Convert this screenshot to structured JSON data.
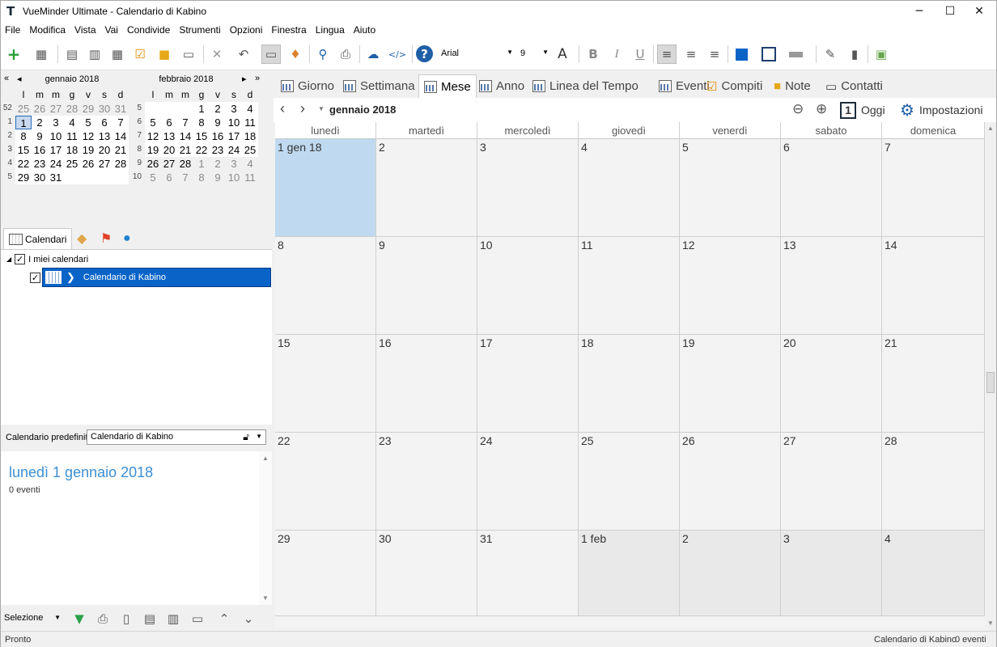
{
  "window": {
    "title": "VueMinder Ultimate - Calendario di Kabino",
    "logo": "T"
  },
  "window_controls": {
    "minimize": "─",
    "maximize": "☐",
    "close": "✕"
  },
  "menu": [
    "File",
    "Modifica",
    "Vista",
    "Vai",
    "Condivide",
    "Strumenti",
    "Opzioni",
    "Finestra",
    "Lingua",
    "Aiuto"
  ],
  "toolbar": {
    "font_name": "Arial",
    "font_size": "9",
    "font_size_glyph": "A",
    "bold": "B",
    "italic": "I",
    "underline": "U"
  },
  "mini_calendars": [
    {
      "title": "gennaio 2018",
      "dow": [
        "l",
        "m",
        "m",
        "g",
        "v",
        "s",
        "d"
      ],
      "weeks": [
        {
          "wk": "52",
          "days": [
            [
              "25",
              1
            ],
            [
              "26",
              1
            ],
            [
              "27",
              1
            ],
            [
              "28",
              1
            ],
            [
              "29",
              1
            ],
            [
              "30",
              1
            ],
            [
              "31",
              1
            ]
          ]
        },
        {
          "wk": "1",
          "days": [
            [
              "1",
              0
            ],
            [
              "2",
              0
            ],
            [
              "3",
              0
            ],
            [
              "4",
              0
            ],
            [
              "5",
              0
            ],
            [
              "6",
              0
            ],
            [
              "7",
              0
            ]
          ]
        },
        {
          "wk": "2",
          "days": [
            [
              "8",
              0
            ],
            [
              "9",
              0
            ],
            [
              "10",
              0
            ],
            [
              "11",
              0
            ],
            [
              "12",
              0
            ],
            [
              "13",
              0
            ],
            [
              "14",
              0
            ]
          ]
        },
        {
          "wk": "3",
          "days": [
            [
              "15",
              0
            ],
            [
              "16",
              0
            ],
            [
              "17",
              0
            ],
            [
              "18",
              0
            ],
            [
              "19",
              0
            ],
            [
              "20",
              0
            ],
            [
              "21",
              0
            ]
          ]
        },
        {
          "wk": "4",
          "days": [
            [
              "22",
              0
            ],
            [
              "23",
              0
            ],
            [
              "24",
              0
            ],
            [
              "25",
              0
            ],
            [
              "26",
              0
            ],
            [
              "27",
              0
            ],
            [
              "28",
              0
            ]
          ]
        },
        {
          "wk": "5",
          "days": [
            [
              "29",
              0
            ],
            [
              "30",
              0
            ],
            [
              "31",
              0
            ],
            [
              "",
              1
            ],
            [
              "",
              1
            ],
            [
              "",
              1
            ],
            [
              "",
              1
            ]
          ]
        }
      ]
    },
    {
      "title": "febbraio 2018",
      "dow": [
        "l",
        "m",
        "m",
        "g",
        "v",
        "s",
        "d"
      ],
      "weeks": [
        {
          "wk": "5",
          "days": [
            [
              "",
              1
            ],
            [
              "",
              1
            ],
            [
              "",
              1
            ],
            [
              "1",
              0
            ],
            [
              "2",
              0
            ],
            [
              "3",
              0
            ],
            [
              "4",
              0
            ]
          ]
        },
        {
          "wk": "6",
          "days": [
            [
              "5",
              0
            ],
            [
              "6",
              0
            ],
            [
              "7",
              0
            ],
            [
              "8",
              0
            ],
            [
              "9",
              0
            ],
            [
              "10",
              0
            ],
            [
              "11",
              0
            ]
          ]
        },
        {
          "wk": "7",
          "days": [
            [
              "12",
              0
            ],
            [
              "13",
              0
            ],
            [
              "14",
              0
            ],
            [
              "15",
              0
            ],
            [
              "16",
              0
            ],
            [
              "17",
              0
            ],
            [
              "18",
              0
            ]
          ]
        },
        {
          "wk": "8",
          "days": [
            [
              "19",
              0
            ],
            [
              "20",
              0
            ],
            [
              "21",
              0
            ],
            [
              "22",
              0
            ],
            [
              "23",
              0
            ],
            [
              "24",
              0
            ],
            [
              "25",
              0
            ]
          ]
        },
        {
          "wk": "9",
          "days": [
            [
              "26",
              0
            ],
            [
              "27",
              0
            ],
            [
              "28",
              0
            ],
            [
              "1",
              1
            ],
            [
              "2",
              1
            ],
            [
              "3",
              1
            ],
            [
              "4",
              1
            ]
          ]
        },
        {
          "wk": "10",
          "days": [
            [
              "5",
              1
            ],
            [
              "6",
              1
            ],
            [
              "7",
              1
            ],
            [
              "8",
              1
            ],
            [
              "9",
              1
            ],
            [
              "10",
              1
            ],
            [
              "11",
              1
            ]
          ]
        }
      ]
    }
  ],
  "left_tabs": {
    "calendars_label": "Calendari"
  },
  "tree": {
    "root_label": "I miei calendari",
    "calendar_label": "Calendario di Kabino"
  },
  "default_calendar": {
    "label": "Calendario predefinito:",
    "value": "Calendario di Kabino"
  },
  "info_pane": {
    "date": "lunedì 1 gennaio 2018",
    "events": "0 eventi"
  },
  "bottom_bar": {
    "selection_label": "Selezione"
  },
  "view_tabs": [
    "Giorno",
    "Settimana",
    "Mese",
    "Anno",
    "Linea del Tempo",
    "Eventi",
    "Compiti",
    "Note",
    "Contatti"
  ],
  "active_view": "Mese",
  "navbar": {
    "month_title": "gennaio 2018",
    "today_label": "Oggi",
    "today_icon_number": "1",
    "settings_label": "Impostazioni"
  },
  "month_grid": {
    "day_headers": [
      "lunedì",
      "martedì",
      "mercoledì",
      "giovedì",
      "venerdì",
      "sabato",
      "domenica"
    ],
    "weeks": [
      [
        [
          "1 gen 18",
          "sel"
        ],
        [
          "2",
          ""
        ],
        [
          "3",
          ""
        ],
        [
          "4",
          ""
        ],
        [
          "5",
          ""
        ],
        [
          "6",
          ""
        ],
        [
          "7",
          ""
        ]
      ],
      [
        [
          "8",
          ""
        ],
        [
          "9",
          ""
        ],
        [
          "10",
          ""
        ],
        [
          "11",
          ""
        ],
        [
          "12",
          ""
        ],
        [
          "13",
          ""
        ],
        [
          "14",
          ""
        ]
      ],
      [
        [
          "15",
          ""
        ],
        [
          "16",
          ""
        ],
        [
          "17",
          ""
        ],
        [
          "18",
          ""
        ],
        [
          "19",
          ""
        ],
        [
          "20",
          ""
        ],
        [
          "21",
          ""
        ]
      ],
      [
        [
          "22",
          ""
        ],
        [
          "23",
          ""
        ],
        [
          "24",
          ""
        ],
        [
          "25",
          ""
        ],
        [
          "26",
          ""
        ],
        [
          "27",
          ""
        ],
        [
          "28",
          ""
        ]
      ],
      [
        [
          "29",
          ""
        ],
        [
          "30",
          ""
        ],
        [
          "31",
          ""
        ],
        [
          "1 feb",
          "other"
        ],
        [
          "2",
          "other"
        ],
        [
          "3",
          "other"
        ],
        [
          "4",
          "other"
        ]
      ]
    ]
  },
  "status_bar": {
    "left": "Pronto",
    "calendar": "Calendario di Kabino",
    "events": "0 eventi"
  },
  "colors": {
    "accent": "#0a64c8",
    "selected_day": "#bfdaf0",
    "info_date": "#3b8fd4"
  }
}
